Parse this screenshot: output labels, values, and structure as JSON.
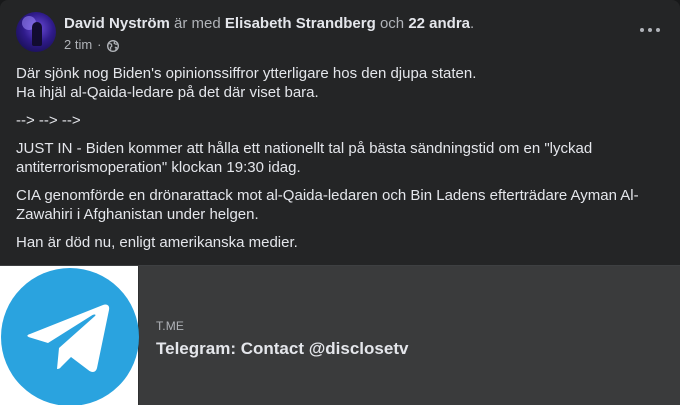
{
  "header": {
    "author": "David Nyström",
    "with_text": "är med",
    "tagged": "Elisabeth Strandberg",
    "and_text": "och",
    "others": "22 andra",
    "period": ".",
    "time": "2 tim",
    "separator": "·",
    "audience_icon": "globe-icon",
    "more_icon": "more-options-icon"
  },
  "post": {
    "paragraphs": [
      "Där sjönk nog Biden's opinionssiffror ytterligare hos den djupa staten.",
      "Ha ihjäl al-Qaida-ledare på det där viset bara.",
      "--> --> -->",
      "JUST IN - Biden kommer att hålla ett nationellt tal på bästa sändningstid om en \"lyckad antiterrorismoperation\" klockan 19:30 idag.",
      "CIA genomförde en drönarattack mot al-Qaida-ledaren och Bin Ladens efterträdare Ayman Al-Zawahiri i Afghanistan under helgen.",
      "Han är död nu, enligt amerikanska medier."
    ]
  },
  "link_preview": {
    "domain": "T.ME",
    "title": "Telegram: Contact @disclosetv",
    "thumb_icon": "telegram-logo-icon",
    "brand_color": "#2aa3df"
  },
  "colors": {
    "card_bg": "#242526",
    "preview_bg": "#3a3b3c",
    "primary_text": "#e4e6eb",
    "secondary_text": "#b0b3b8"
  }
}
